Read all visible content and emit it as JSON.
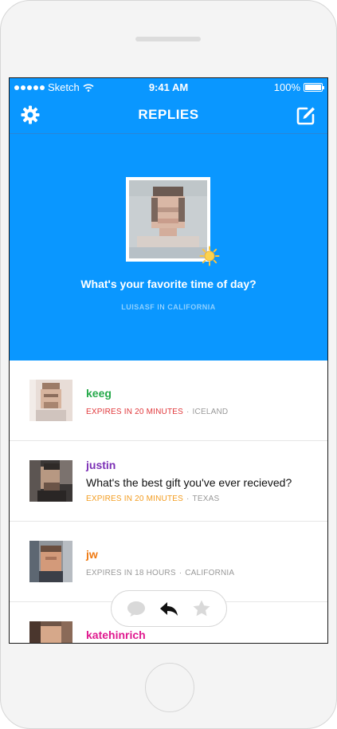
{
  "status_bar": {
    "carrier": "Sketch",
    "time": "9:41 AM",
    "battery": "100%"
  },
  "nav": {
    "title": "REPLIES",
    "settings_icon": "gear-icon",
    "compose_icon": "compose-icon"
  },
  "hero": {
    "question": "What's your favorite time of day?",
    "username": "LUISASF",
    "in_word": "IN",
    "location": "CALIFORNIA",
    "badge_icon": "sun-icon"
  },
  "replies": [
    {
      "user": "keeg",
      "user_color": "#25a94a",
      "text": "",
      "expires": "EXPIRES IN 20 MINUTES",
      "expires_color": "#e0373a",
      "location": "ICELAND"
    },
    {
      "user": "justin",
      "user_color": "#7b2fb5",
      "text": "What's the best gift you've ever recieved?",
      "expires": "EXPIRES IN 20 MINUTES",
      "expires_color": "#f39c1f",
      "location": "TEXAS"
    },
    {
      "user": "jw",
      "user_color": "#ef7a12",
      "text": "",
      "expires": "EXPIRES IN 18 HOURS",
      "expires_color": "#999999",
      "location": "CALIFORNIA"
    },
    {
      "user": "katehinrich",
      "user_color": "#e01a8f",
      "text": "",
      "expires": "",
      "expires_color": "#999999",
      "location": ""
    }
  ],
  "action_bar": {
    "icons": [
      "speech-bubble-icon",
      "reply-arrow-icon",
      "star-icon"
    ]
  },
  "colors": {
    "accent": "#0a97ff"
  }
}
